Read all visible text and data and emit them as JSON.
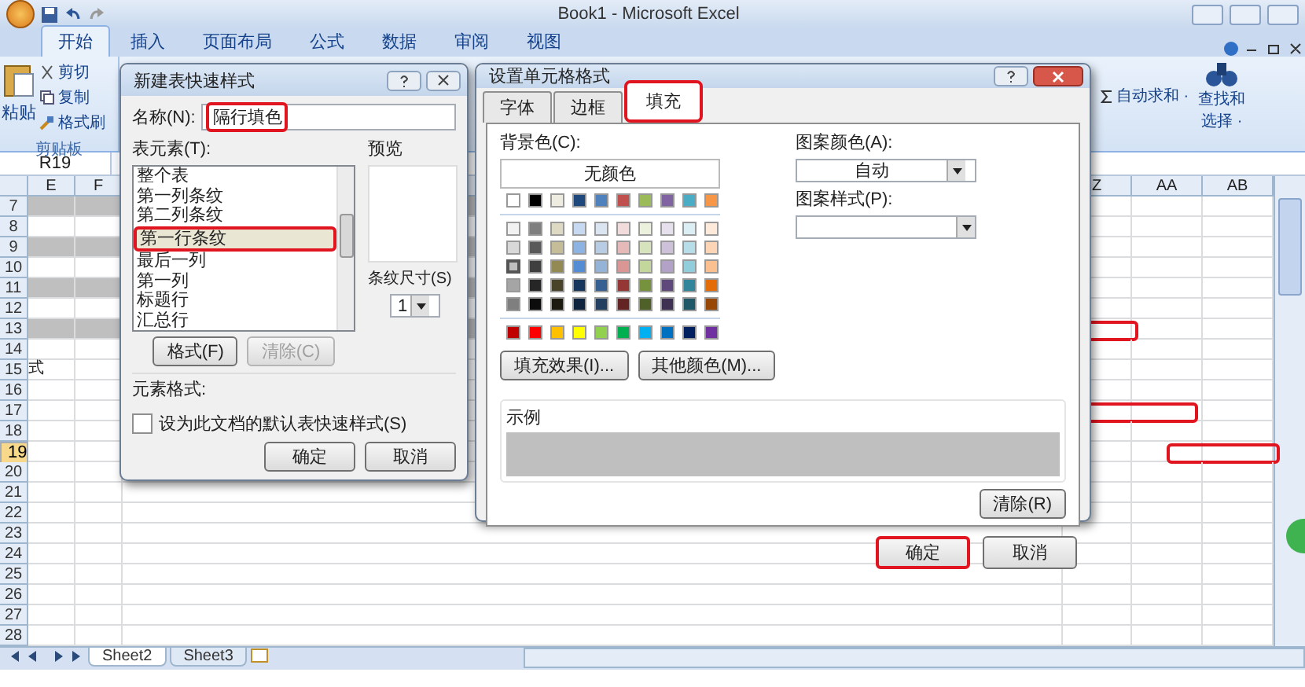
{
  "window": {
    "title": "Book1 - Microsoft Excel"
  },
  "ribbon_tabs": [
    {
      "label": "开始",
      "selected": true
    },
    {
      "label": "插入",
      "selected": false
    },
    {
      "label": "页面布局",
      "selected": false
    },
    {
      "label": "公式",
      "selected": false
    },
    {
      "label": "数据",
      "selected": false
    },
    {
      "label": "审阅",
      "selected": false
    },
    {
      "label": "视图",
      "selected": false
    }
  ],
  "clipboard": {
    "paste": "粘贴",
    "cut": "剪切",
    "copy": "复制",
    "format_painter": "格式刷",
    "group_label": "剪贴板"
  },
  "editing": {
    "autosum": "自动求和 ·",
    "find": "查找和",
    "select": "选择 ·"
  },
  "name_box": "R19",
  "columns": [
    "E",
    "F",
    "",
    "Z",
    "AA",
    "AB"
  ],
  "rows": [
    {
      "label": "7",
      "shaded": true,
      "selected": false
    },
    {
      "label": "8",
      "shaded": false,
      "selected": false
    },
    {
      "label": "9",
      "shaded": true,
      "selected": false
    },
    {
      "label": "10",
      "shaded": false,
      "selected": false
    },
    {
      "label": "11",
      "shaded": true,
      "selected": false
    },
    {
      "label": "12",
      "shaded": false,
      "selected": false
    },
    {
      "label": "13",
      "shaded": true,
      "selected": false,
      "highlighted": true
    },
    {
      "label": "14",
      "shaded": false,
      "selected": false
    },
    {
      "label": "15",
      "shaded": false,
      "selected": false,
      "text": "式"
    },
    {
      "label": "16",
      "shaded": false,
      "selected": false
    },
    {
      "label": "17",
      "shaded": false,
      "selected": false,
      "highlighted": true
    },
    {
      "label": "18",
      "shaded": false,
      "selected": false
    },
    {
      "label": "19",
      "shaded": false,
      "selected": true,
      "highlighted": true
    },
    {
      "label": "20",
      "shaded": false,
      "selected": false
    },
    {
      "label": "21",
      "shaded": false,
      "selected": false
    },
    {
      "label": "22",
      "shaded": false,
      "selected": false
    },
    {
      "label": "23",
      "shaded": false,
      "selected": false
    },
    {
      "label": "24",
      "shaded": false,
      "selected": false
    },
    {
      "label": "25",
      "shaded": false,
      "selected": false
    },
    {
      "label": "26",
      "shaded": false,
      "selected": false
    },
    {
      "label": "27",
      "shaded": false,
      "selected": false
    },
    {
      "label": "28",
      "shaded": false,
      "selected": false
    }
  ],
  "sheet_tabs": [
    {
      "label": "Sheet2",
      "selected": true
    },
    {
      "label": "Sheet3",
      "selected": false
    }
  ],
  "table_style_dialog": {
    "title": "新建表快速样式",
    "name_label": "名称(N):",
    "name_value": "隔行填色",
    "name_highlighted": true,
    "elements_label": "表元素(T):",
    "elements": [
      {
        "label": "整个表",
        "selected": false,
        "highlighted": false
      },
      {
        "label": "第一列条纹",
        "selected": false,
        "highlighted": false
      },
      {
        "label": "第二列条纹",
        "selected": false,
        "highlighted": false
      },
      {
        "label": "第一行条纹",
        "selected": true,
        "highlighted": true
      },
      {
        "label": "最后一列",
        "selected": false,
        "highlighted": false
      },
      {
        "label": "第一列",
        "selected": false,
        "highlighted": false
      },
      {
        "label": "标题行",
        "selected": false,
        "highlighted": false
      },
      {
        "label": "汇总行",
        "selected": false,
        "highlighted": false
      }
    ],
    "format_button": {
      "label": "格式(F)",
      "disabled": false
    },
    "clear_button": {
      "label": "清除(C)",
      "disabled": true
    },
    "preview_label": "预览",
    "stripe_size_label": "条纹尺寸(S)",
    "stripe_size": "1",
    "element_format_label": "元素格式:",
    "default_checkbox": {
      "label": "设为此文档的默认表快速样式(S)",
      "checked": false
    },
    "ok": "确定",
    "cancel": "取消"
  },
  "format_cells_dialog": {
    "title": "设置单元格格式",
    "tabs": [
      {
        "label": "字体",
        "selected": false,
        "highlighted": false
      },
      {
        "label": "边框",
        "selected": false,
        "highlighted": false
      },
      {
        "label": "填充",
        "selected": true,
        "highlighted": true
      }
    ],
    "background_label": "背景色(C):",
    "no_color": "无颜色",
    "theme_colors": [
      {
        "color": "#ffffff",
        "selected": false
      },
      {
        "color": "#000000",
        "selected": false
      },
      {
        "color": "#eeece1",
        "selected": false
      },
      {
        "color": "#1f497d",
        "selected": false
      },
      {
        "color": "#4f81bd",
        "selected": false
      },
      {
        "color": "#c0504d",
        "selected": false
      },
      {
        "color": "#9bbb59",
        "selected": false
      },
      {
        "color": "#8064a2",
        "selected": false
      },
      {
        "color": "#4bacc6",
        "selected": false
      },
      {
        "color": "#f79646",
        "selected": false
      }
    ],
    "tint_rows": [
      [
        {
          "color": "#f2f2f2",
          "selected": false
        },
        {
          "color": "#7f7f7f",
          "selected": false
        },
        {
          "color": "#ddd9c3",
          "selected": false
        },
        {
          "color": "#c6d9f0",
          "selected": false
        },
        {
          "color": "#dbe5f1",
          "selected": false
        },
        {
          "color": "#f2dcdb",
          "selected": false
        },
        {
          "color": "#ebf1dd",
          "selected": false
        },
        {
          "color": "#e5e0ec",
          "selected": false
        },
        {
          "color": "#dbeef3",
          "selected": false
        },
        {
          "color": "#fdeada",
          "selected": false
        }
      ],
      [
        {
          "color": "#d8d8d8",
          "selected": false
        },
        {
          "color": "#595959",
          "selected": false
        },
        {
          "color": "#c4bd97",
          "selected": false
        },
        {
          "color": "#8db3e2",
          "selected": false
        },
        {
          "color": "#b8cce4",
          "selected": false
        },
        {
          "color": "#e5b9b7",
          "selected": false
        },
        {
          "color": "#d7e3bc",
          "selected": false
        },
        {
          "color": "#ccc1d9",
          "selected": false
        },
        {
          "color": "#b7dde8",
          "selected": false
        },
        {
          "color": "#fbd5b5",
          "selected": false
        }
      ],
      [
        {
          "color": "#bfbfbf",
          "selected": true
        },
        {
          "color": "#3f3f3f",
          "selected": false
        },
        {
          "color": "#938953",
          "selected": false
        },
        {
          "color": "#548dd4",
          "selected": false
        },
        {
          "color": "#95b3d7",
          "selected": false
        },
        {
          "color": "#d99694",
          "selected": false
        },
        {
          "color": "#c3d69b",
          "selected": false
        },
        {
          "color": "#b2a2c7",
          "selected": false
        },
        {
          "color": "#92cddc",
          "selected": false
        },
        {
          "color": "#fac08f",
          "selected": false
        }
      ],
      [
        {
          "color": "#a5a5a5",
          "selected": false
        },
        {
          "color": "#262626",
          "selected": false
        },
        {
          "color": "#494429",
          "selected": false
        },
        {
          "color": "#17365d",
          "selected": false
        },
        {
          "color": "#366092",
          "selected": false
        },
        {
          "color": "#953734",
          "selected": false
        },
        {
          "color": "#76923c",
          "selected": false
        },
        {
          "color": "#5f497a",
          "selected": false
        },
        {
          "color": "#31859b",
          "selected": false
        },
        {
          "color": "#e36c09",
          "selected": false
        }
      ],
      [
        {
          "color": "#7f7f7f",
          "selected": false
        },
        {
          "color": "#0c0c0c",
          "selected": false
        },
        {
          "color": "#1d1b10",
          "selected": false
        },
        {
          "color": "#0f243e",
          "selected": false
        },
        {
          "color": "#244061",
          "selected": false
        },
        {
          "color": "#632423",
          "selected": false
        },
        {
          "color": "#4f6128",
          "selected": false
        },
        {
          "color": "#3f3151",
          "selected": false
        },
        {
          "color": "#205867",
          "selected": false
        },
        {
          "color": "#974806",
          "selected": false
        }
      ]
    ],
    "standard_colors": [
      {
        "color": "#c00000",
        "selected": false
      },
      {
        "color": "#ff0000",
        "selected": false
      },
      {
        "color": "#ffc000",
        "selected": false
      },
      {
        "color": "#ffff00",
        "selected": false
      },
      {
        "color": "#92d050",
        "selected": false
      },
      {
        "color": "#00b050",
        "selected": false
      },
      {
        "color": "#00b0f0",
        "selected": false
      },
      {
        "color": "#0070c0",
        "selected": false
      },
      {
        "color": "#002060",
        "selected": false
      },
      {
        "color": "#7030a0",
        "selected": false
      }
    ],
    "fill_effects": "填充效果(I)...",
    "more_colors": "其他颜色(M)...",
    "pattern_color_label": "图案颜色(A):",
    "pattern_color": "自动",
    "pattern_style_label": "图案样式(P):",
    "sample_label": "示例",
    "clear": "清除(R)",
    "ok": {
      "label": "确定",
      "highlighted": true
    },
    "cancel": "取消"
  }
}
